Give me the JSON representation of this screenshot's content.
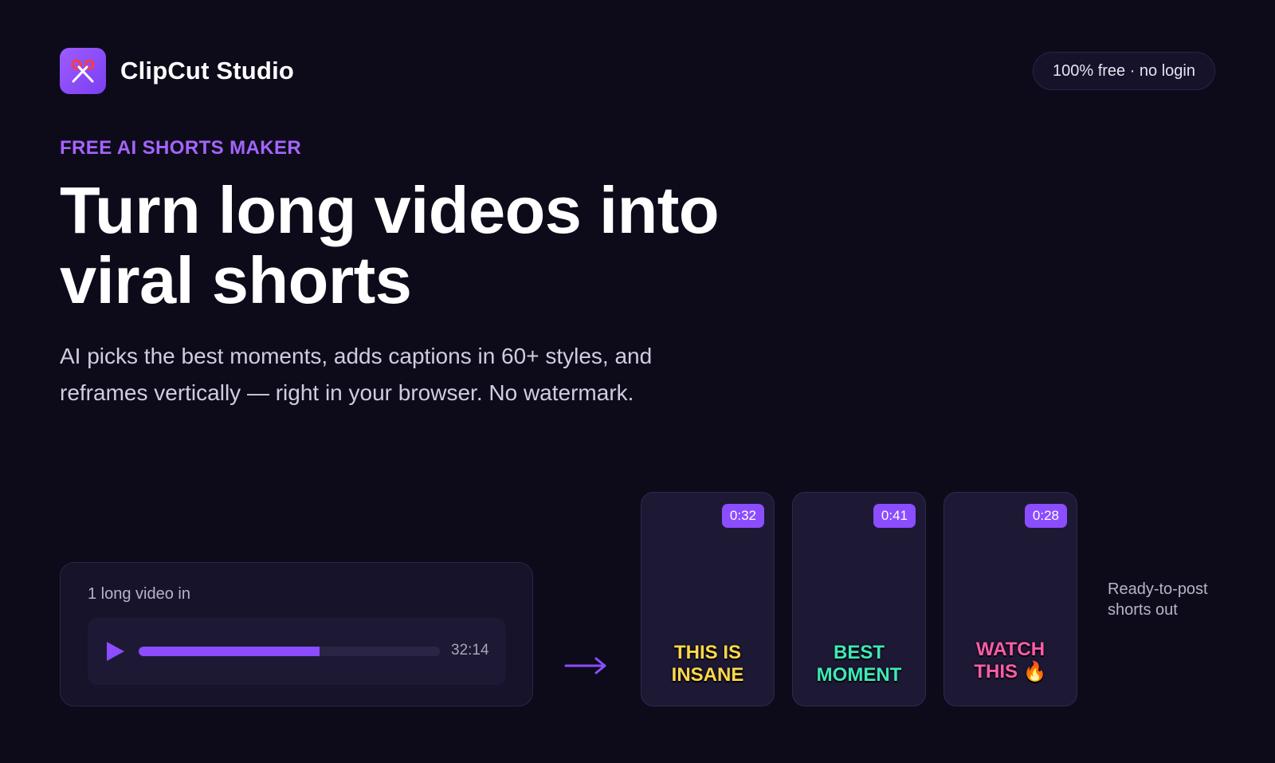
{
  "brand": {
    "name": "ClipCut Studio",
    "logo_icon": "scissors-icon"
  },
  "header": {
    "pill": "100% free · no login"
  },
  "hero": {
    "eyebrow": "FREE AI SHORTS MAKER",
    "headline_line1": "Turn long videos into",
    "headline_line2": "viral shorts",
    "subhead_line1": "AI picks the best moments, adds captions in 60+ styles, and",
    "subhead_line2": "reframes vertically — right in your browser. No watermark."
  },
  "input_video": {
    "label": "1 long video in",
    "duration": "32:14",
    "progress": 0.6
  },
  "shorts": [
    {
      "duration": "0:32",
      "caption_line1": "THIS IS",
      "caption_line2": "INSANE",
      "color": "#ffd84a"
    },
    {
      "duration": "0:41",
      "caption_line1": "BEST",
      "caption_line2": "MOMENT",
      "color": "#3ee8b5"
    },
    {
      "duration": "0:28",
      "caption_line1": "WATCH",
      "caption_line2": "THIS 🔥",
      "color": "#ff5ca8"
    }
  ],
  "output_label_line1": "Ready-to-post",
  "output_label_line2": "shorts out",
  "colors": {
    "accent": "#8b4dff",
    "eyebrow": "#a564ff",
    "background": "#0d0b1a"
  }
}
